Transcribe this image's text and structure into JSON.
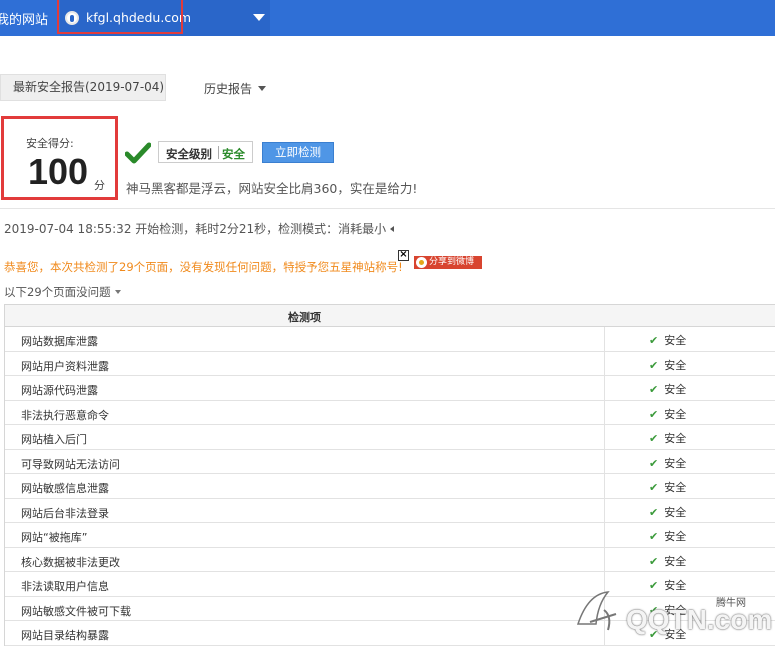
{
  "header": {
    "my_sites": "我的网站",
    "domain": "kfgl.qhdedu.com"
  },
  "report_tabs": {
    "latest": "最新安全报告(2019-07-04)",
    "history": "历史报告"
  },
  "score": {
    "label": "安全得分:",
    "value": "100",
    "unit": "分"
  },
  "level": {
    "label": "安全级别",
    "value": "安全"
  },
  "detect_button": "立即检测",
  "slogan": "神马黑客都是浮云，网站安全比肩360，实在是给力!",
  "scan_info": "2019-07-04 18:55:32 开始检测，耗时2分21秒，检测模式：消耗最小",
  "congrats": "恭喜您，本次共检测了29个页面，没有发现任何问题，特授予您五星神站称号!",
  "share_label": "分享到微博",
  "close_label": "×",
  "pages_summary": "以下29个页面没问题",
  "table": {
    "header": "检测项",
    "rows": [
      {
        "name": "网站数据库泄露",
        "status": "安全"
      },
      {
        "name": "网站用户资料泄露",
        "status": "安全"
      },
      {
        "name": "网站源代码泄露",
        "status": "安全"
      },
      {
        "name": "非法执行恶意命令",
        "status": "安全"
      },
      {
        "name": "网站植入后门",
        "status": "安全"
      },
      {
        "name": "可导致网站无法访问",
        "status": "安全"
      },
      {
        "name": "网站敏感信息泄露",
        "status": "安全"
      },
      {
        "name": "网站后台非法登录",
        "status": "安全"
      },
      {
        "name": "网站“被拖库”",
        "status": "安全"
      },
      {
        "name": "核心数据被非法更改",
        "status": "安全"
      },
      {
        "name": "非法读取用户信息",
        "status": "安全"
      },
      {
        "name": "网站敏感文件被可下载",
        "status": "安全"
      },
      {
        "name": "网站目录结构暴露",
        "status": "安全"
      }
    ]
  },
  "watermark": {
    "brand": "QQTN.com",
    "cn": "腾牛网"
  },
  "colors": {
    "topbar": "#2f6fd6",
    "highlight_red": "#e23b3b",
    "safe_green": "#2a8a2a",
    "congrats_orange": "#f08a1c",
    "button_blue": "#4f96e6"
  }
}
